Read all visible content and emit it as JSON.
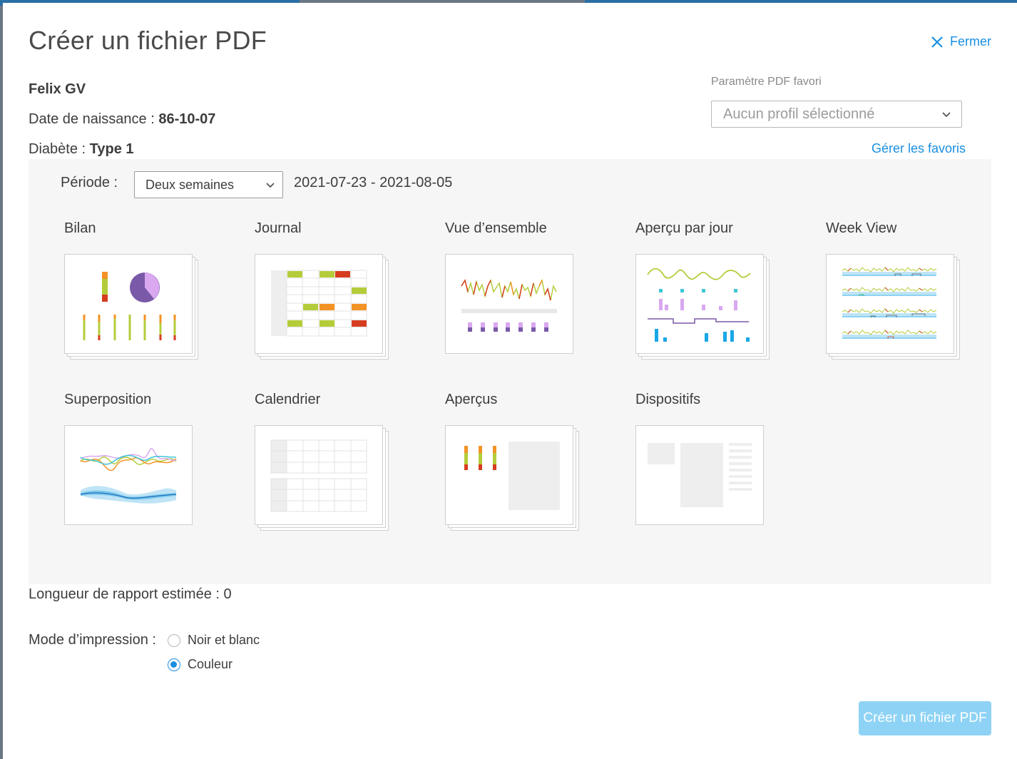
{
  "dialog": {
    "title": "Créer un fichier PDF",
    "close_label": "Fermer"
  },
  "patient": {
    "name": "Felix GV",
    "dob_label": "Date de naissance :",
    "dob_value": "86-10-07",
    "diabetes_label": "Diabète :",
    "diabetes_value": "Type 1"
  },
  "favorites": {
    "label": "Paramètre PDF favori",
    "selected": "Aucun profil sélectionné",
    "manage_link": "Gérer les favoris"
  },
  "period": {
    "label": "Période :",
    "selected": "Deux semaines",
    "range": "2021-07-23 - 2021-08-05"
  },
  "reports": [
    {
      "label": "Bilan",
      "icon": "summary-thumbnail-icon"
    },
    {
      "label": "Journal",
      "icon": "logbook-thumbnail-icon"
    },
    {
      "label": "Vue d’ensemble",
      "icon": "overview-thumbnail-icon"
    },
    {
      "label": "Aperçu par jour",
      "icon": "daily-thumbnail-icon"
    },
    {
      "label": "Week View",
      "icon": "week-view-thumbnail-icon"
    },
    {
      "label": "Superposition",
      "icon": "overlay-thumbnail-icon"
    },
    {
      "label": "Calendrier",
      "icon": "calendar-thumbnail-icon"
    },
    {
      "label": "Aperçus",
      "icon": "insights-thumbnail-icon"
    },
    {
      "label": "Dispositifs",
      "icon": "devices-thumbnail-icon"
    }
  ],
  "estimate": {
    "text": "Longueur de rapport estimée : 0"
  },
  "print_mode": {
    "label": "Mode d’impression :",
    "options": [
      "Noir et blanc",
      "Couleur"
    ],
    "selected": "Couleur"
  },
  "actions": {
    "create_label": "Créer un fichier PDF"
  },
  "colors": {
    "accent": "#1a8fe0",
    "button_disabled": "#8ed3f5",
    "green": "#b5cc3a",
    "orange": "#f39325",
    "red": "#d63c1f",
    "purple": "#7a59a8",
    "lilac": "#d9a8f0",
    "cyan": "#3fc6d6",
    "blue": "#1aa7e8"
  }
}
